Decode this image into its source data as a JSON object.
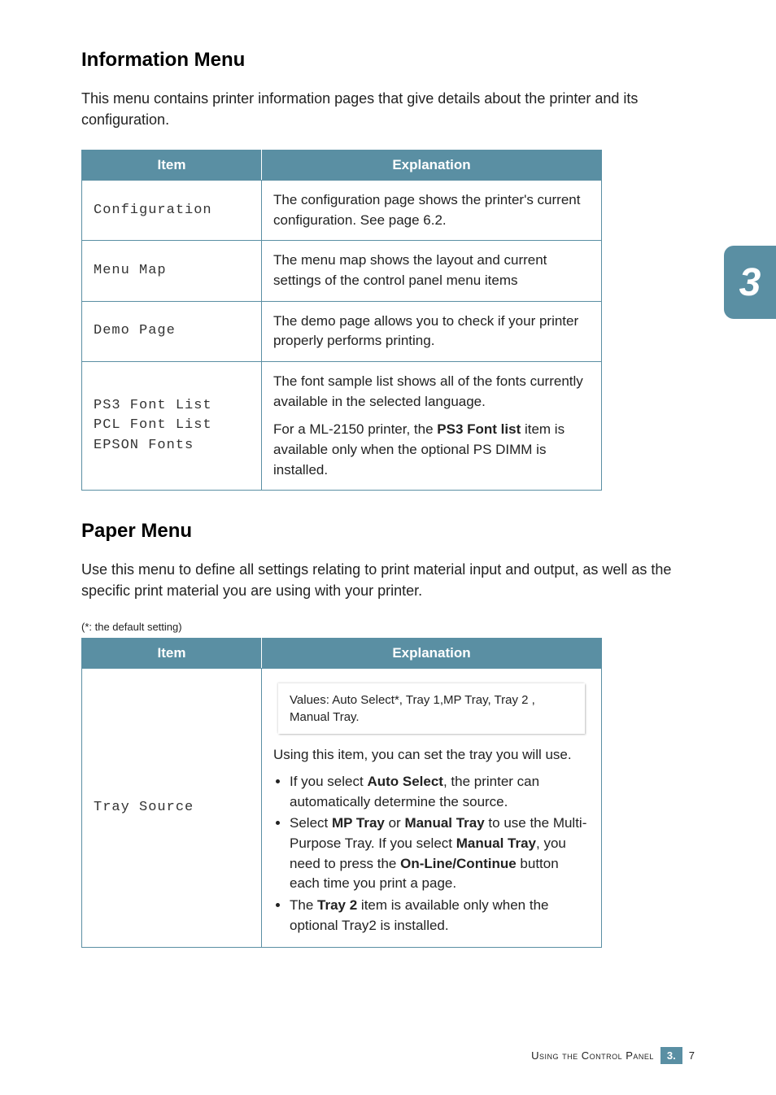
{
  "sideTab": "3",
  "section1": {
    "heading": "Information Menu",
    "lead": "This menu contains printer information pages that give details about the printer and its configuration.",
    "headers": {
      "item": "Item",
      "explanation": "Explanation"
    },
    "rows": [
      {
        "item": "Configuration",
        "explanation": "The configuration page shows the printer's current configuration. See page 6.2."
      },
      {
        "item": "Menu Map",
        "explanation": "The menu map shows the layout and current settings of the control panel menu items"
      },
      {
        "item": "Demo Page",
        "explanation": "The demo page allows you to check if your printer properly performs printing."
      },
      {
        "item": "PS3 Font List\nPCL Font List\nEPSON Fonts",
        "fontPara1": "The font sample list shows all of the fonts currently available in the selected language.",
        "fontPara2a": "For a ML-2150 printer, the ",
        "fontPara2bold": "PS3 Font list",
        "fontPara2b": " item is available only when the optional PS DIMM is installed."
      }
    ]
  },
  "section2": {
    "heading": "Paper Menu",
    "lead": "Use this menu to define all settings relating to print material input and output, as well as the specific print material you are using with your printer.",
    "note": "(*: the default setting)",
    "headers": {
      "item": "Item",
      "explanation": "Explanation"
    },
    "row": {
      "item": "Tray Source",
      "values": "Values: Auto Select*, Tray 1,MP Tray, Tray 2 , Manual Tray.",
      "intro": "Using this item, you can set the tray you will use.",
      "b1a": "If you select ",
      "b1bold": "Auto Select",
      "b1b": ", the printer can automatically determine the source.",
      "b2a": "Select ",
      "b2bold1": "MP Tray",
      "b2mid1": " or ",
      "b2bold2": "Manual Tray",
      "b2mid2": " to use the Multi-Purpose Tray. If you select ",
      "b2bold3": "Manual Tray",
      "b2mid3": ", you need to press the ",
      "b2bold4": "On-Line/Continue",
      "b2end": " button each time you print a page.",
      "b3a": "The ",
      "b3bold": "Tray 2",
      "b3b": " item is available only when the optional Tray2 is installed."
    }
  },
  "footer": {
    "label": "Using the Control Panel",
    "chapter": "3.",
    "page": "7"
  }
}
